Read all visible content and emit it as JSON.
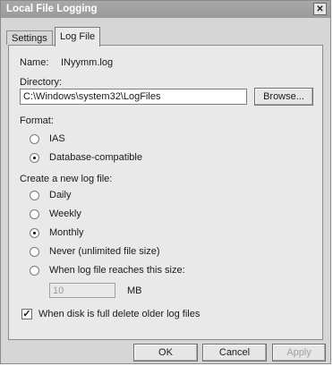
{
  "window": {
    "title": "Local File Logging",
    "close_glyph": "✕"
  },
  "tabs": [
    {
      "label": "Settings",
      "active": false
    },
    {
      "label": "Log File",
      "active": true
    }
  ],
  "name_row": {
    "label": "Name:",
    "value": "INyymm.log"
  },
  "directory": {
    "label": "Directory:",
    "value": "C:\\Windows\\system32\\LogFiles",
    "browse_label": "Browse..."
  },
  "format": {
    "label": "Format:",
    "options": [
      {
        "label": "IAS",
        "selected": false
      },
      {
        "label": "Database-compatible",
        "selected": true
      }
    ]
  },
  "new_log": {
    "label": "Create a new log file:",
    "options": [
      {
        "label": "Daily",
        "selected": false
      },
      {
        "label": "Weekly",
        "selected": false
      },
      {
        "label": "Monthly",
        "selected": true
      },
      {
        "label": "Never (unlimited file size)",
        "selected": false
      },
      {
        "label": "When log file reaches this size:",
        "selected": false
      }
    ],
    "size_value": "10",
    "size_unit": "MB"
  },
  "delete_older": {
    "label": "When disk is full delete older log files",
    "checked": true,
    "check_glyph": "✓"
  },
  "buttons": {
    "ok": "OK",
    "cancel": "Cancel",
    "apply": "Apply"
  }
}
